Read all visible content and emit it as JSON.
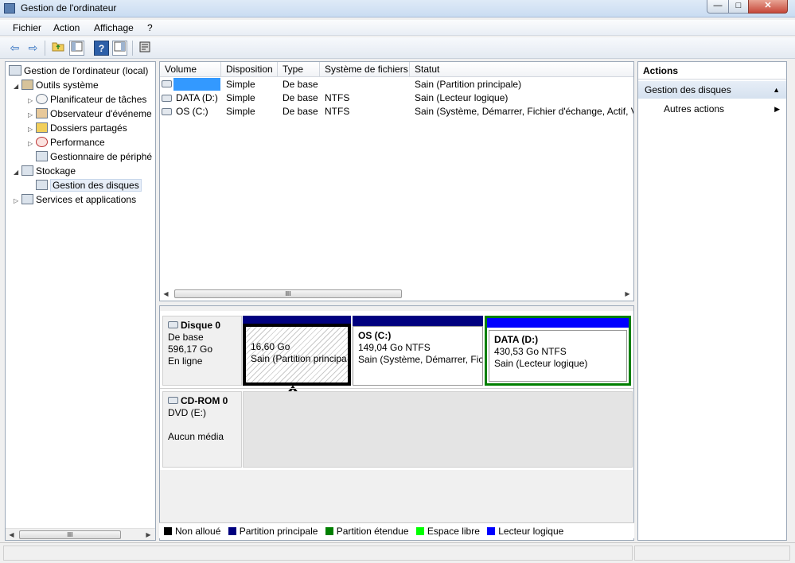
{
  "window": {
    "title": "Gestion de l'ordinateur",
    "close_glyph": "✕",
    "minimize_glyph": "—",
    "maximize_glyph": "□"
  },
  "menu": [
    "Fichier",
    "Action",
    "Affichage",
    "?"
  ],
  "toolbar": {
    "help_glyph": "?",
    "back_glyph": "⇦",
    "forward_glyph": "⇨"
  },
  "tree": {
    "root": "Gestion de l'ordinateur (local)",
    "outils": "Outils système",
    "planificateur": "Planificateur de tâches",
    "observateur": "Observateur d'événeme",
    "dossiers": "Dossiers partagés",
    "performance": "Performance",
    "gestionnaire": "Gestionnaire de périphé",
    "stockage": "Stockage",
    "gestion_disques": "Gestion des disques",
    "services": "Services et applications",
    "scroll_grip": "III"
  },
  "volumes": {
    "columns": [
      "Volume",
      "Disposition",
      "Type",
      "Système de fichiers",
      "Statut"
    ],
    "rows": [
      {
        "volume": "",
        "disposition": "Simple",
        "type": "De base",
        "fs": "",
        "statut": "Sain (Partition principale)"
      },
      {
        "volume": "DATA (D:)",
        "disposition": "Simple",
        "type": "De base",
        "fs": "NTFS",
        "statut": "Sain (Lecteur logique)"
      },
      {
        "volume": "OS (C:)",
        "disposition": "Simple",
        "type": "De base",
        "fs": "NTFS",
        "statut": "Sain (Système, Démarrer, Fichier d'échange, Actif, Vi"
      }
    ],
    "scroll_grip": "III"
  },
  "disk0": {
    "name": "Disque 0",
    "type": "De base",
    "size": "596,17 Go",
    "state": "En ligne",
    "partitions": [
      {
        "label": "",
        "size": "16,60 Go",
        "status": "Sain (Partition principa"
      },
      {
        "label": "OS  (C:)",
        "size": "149,04 Go NTFS",
        "status": "Sain (Système, Démarrer, Ficl"
      },
      {
        "label": "DATA  (D:)",
        "size": "430,53 Go NTFS",
        "status": "Sain (Lecteur logique)"
      }
    ]
  },
  "cdrom": {
    "name": "CD-ROM 0",
    "drive": "DVD (E:)",
    "state": "Aucun média"
  },
  "legend": [
    {
      "label": "Non alloué",
      "color": "#000000"
    },
    {
      "label": "Partition principale",
      "color": "#00007f"
    },
    {
      "label": "Partition étendue",
      "color": "#007f00"
    },
    {
      "label": "Espace libre",
      "color": "#00ff00"
    },
    {
      "label": "Lecteur logique",
      "color": "#0000ff"
    }
  ],
  "actions": {
    "title": "Actions",
    "section": "Gestion des disques",
    "item": "Autres actions"
  },
  "colors": {
    "selection": "#3399ff",
    "primary_partition": "#00007f",
    "logical_drive": "#0000ff",
    "extended_partition": "#007f00"
  }
}
